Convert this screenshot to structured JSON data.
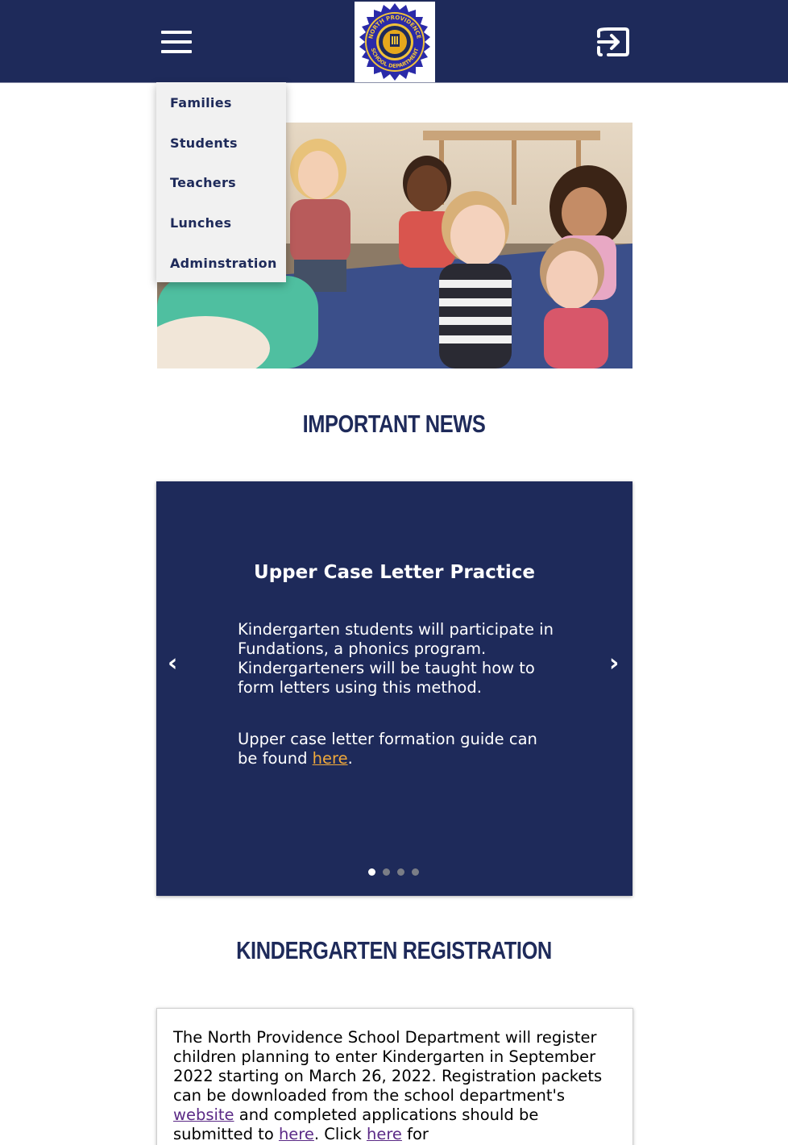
{
  "header": {
    "logo_text_top": "NORTH PROVIDENCE",
    "logo_text_bottom": "SCHOOL DEPARTMENT",
    "colors": {
      "navy": "#1e2a5a",
      "gold": "#f0c23a",
      "royal": "#2a2aa8"
    }
  },
  "menu": {
    "items": [
      {
        "label": "Families"
      },
      {
        "label": "Students"
      },
      {
        "label": "Teachers"
      },
      {
        "label": "Lunches"
      },
      {
        "label": "Adminstration"
      }
    ]
  },
  "news": {
    "heading": "IMPORTANT NEWS",
    "slide": {
      "title": "Upper Case Letter Practice",
      "paragraph1": "Kindergarten students will participate in Fundations, a phonics program. Kindergarteners will be taught how to form letters using this method.",
      "paragraph2_before": "Upper case letter formation guide can be found ",
      "paragraph2_link": "here",
      "paragraph2_after": "."
    },
    "prev_label": "‹",
    "next_label": "›",
    "dots_total": 4,
    "active_dot": 1
  },
  "registration": {
    "heading": "KINDERGARTEN REGISTRATION",
    "text_part1": "The North Providence School Department will register children planning to enter Kindergarten in September 2022 starting on March 26, 2022. Registration packets can be downloaded from the school department's ",
    "link_website": "website",
    "text_part2": " and completed applications should be submitted to ",
    "link_here1": "here",
    "text_part3": ". Click ",
    "link_here2": "here",
    "text_part4": " for"
  },
  "icons": {
    "menu": "hamburger-menu-icon",
    "logout": "sign-out-icon"
  }
}
